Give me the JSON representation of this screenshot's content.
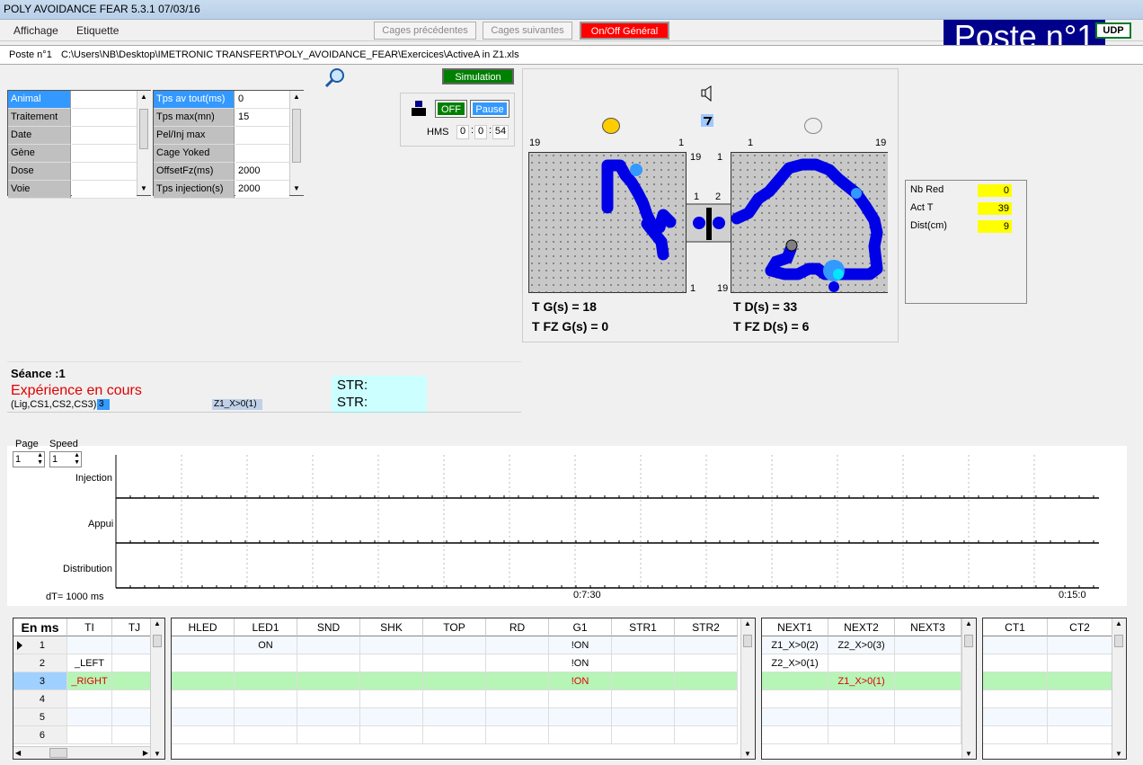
{
  "window": {
    "title": "POLY AVOIDANCE FEAR 5.3.1  07/03/16"
  },
  "menu": {
    "affichage": "Affichage",
    "etiquette": "Etiquette"
  },
  "toolbar": {
    "prev": "Cages précédentes",
    "next": "Cages suivantes",
    "onoff": "On/Off Général"
  },
  "poste": {
    "title": "Poste n°1",
    "udp": "UDP"
  },
  "path": {
    "label": "Poste n°1",
    "file": "C:\\Users\\NB\\Desktop\\IMETRONIC TRANSFERT\\POLY_AVOIDANCE_FEAR\\Exercices\\ActiveA in Z1.xls"
  },
  "animal_grid": [
    {
      "label": "Animal",
      "value": ""
    },
    {
      "label": "Traitement",
      "value": ""
    },
    {
      "label": "Date",
      "value": ""
    },
    {
      "label": "Gène",
      "value": ""
    },
    {
      "label": "Dose",
      "value": ""
    },
    {
      "label": "Voie",
      "value": ""
    }
  ],
  "param_grid": [
    {
      "label": "Tps av tout(ms)",
      "value": "0"
    },
    {
      "label": "Tps max(mn)",
      "value": "15"
    },
    {
      "label": "Pel/Inj max",
      "value": ""
    },
    {
      "label": "Cage Yoked",
      "value": ""
    },
    {
      "label": "OffsetFz(ms)",
      "value": "2000"
    },
    {
      "label": "Tps injection(s)",
      "value": "2000"
    }
  ],
  "controls": {
    "simulation": "Simulation",
    "off": "OFF",
    "pause": "Pause",
    "hms_label": "HMS",
    "h": "0",
    "m": "0",
    "s": "54"
  },
  "maze": {
    "left_top_left": "19",
    "left_top_right": "1",
    "left_right_top": "19",
    "left_right_bottom": "1",
    "mid_left": "1",
    "mid_right": "2",
    "right_left_top": "1",
    "right_top_left": "1",
    "right_top_right": "19",
    "right_bottom_left": "19",
    "tg": "T G(s)  =  18",
    "tfzg": "T FZ G(s)  =  0",
    "td": "T D(s)  =  33",
    "tfzd": "T FZ D(s)  =  6"
  },
  "counters": [
    {
      "label": "Nb Red",
      "value": "0"
    },
    {
      "label": "Act T",
      "value": "39"
    },
    {
      "label": "Dist(cm)",
      "value": "9"
    }
  ],
  "session": {
    "seance": "Séance :1",
    "status": "Expérience en cours",
    "lig": "(Lig,CS1,CS2,CS3)",
    "lig_val": "3",
    "z1": "Z1_X>0(1)",
    "str1": "STR:",
    "str2": "STR:"
  },
  "timeline": {
    "page_label": "Page",
    "speed_label": "Speed",
    "page": "1",
    "speed": "1",
    "rows": [
      "Injection",
      "Appui",
      "Distribution"
    ],
    "dt": "dT=  1000 ms",
    "t1": "0:7:30",
    "t2": "0:15:0"
  },
  "table1": {
    "corner": "En ms",
    "headers": [
      "TI",
      "TJ"
    ],
    "rows": [
      [
        "1",
        "",
        ""
      ],
      [
        "2",
        "_LEFT",
        ""
      ],
      [
        "3",
        "_RIGHT",
        ""
      ],
      [
        "4",
        "",
        ""
      ],
      [
        "5",
        "",
        ""
      ],
      [
        "6",
        "",
        ""
      ]
    ]
  },
  "table2": {
    "headers": [
      "HLED",
      "LED1",
      "SND",
      "SHK",
      "TOP",
      "RD",
      "G1",
      "STR1",
      "STR2"
    ],
    "rows": [
      [
        "",
        "ON",
        "",
        "",
        "",
        "",
        "!ON",
        "",
        ""
      ],
      [
        "",
        "",
        "",
        "",
        "",
        "",
        "!ON",
        "",
        ""
      ],
      [
        "",
        "",
        "",
        "",
        "",
        "",
        "!ON",
        "",
        ""
      ],
      [
        "",
        "",
        "",
        "",
        "",
        "",
        "",
        "",
        ""
      ],
      [
        "",
        "",
        "",
        "",
        "",
        "",
        "",
        "",
        ""
      ],
      [
        "",
        "",
        "",
        "",
        "",
        "",
        "",
        "",
        ""
      ]
    ]
  },
  "table3": {
    "headers": [
      "NEXT1",
      "NEXT2",
      "NEXT3"
    ],
    "rows": [
      [
        "Z1_X>0(2)",
        "Z2_X>0(3)",
        ""
      ],
      [
        "Z2_X>0(1)",
        "",
        ""
      ],
      [
        "",
        "Z1_X>0(1)",
        ""
      ],
      [
        "",
        "",
        ""
      ],
      [
        "",
        "",
        ""
      ],
      [
        "",
        "",
        ""
      ]
    ]
  },
  "table4": {
    "headers": [
      "CT1",
      "CT2"
    ],
    "rows": [
      [
        "",
        ""
      ],
      [
        "",
        ""
      ],
      [
        "",
        ""
      ],
      [
        "",
        ""
      ],
      [
        "",
        ""
      ],
      [
        "",
        ""
      ]
    ]
  },
  "colors": {
    "selected_row": "#b6f5b6",
    "track": "#0000e6",
    "accent_blue": "#3399ff"
  }
}
